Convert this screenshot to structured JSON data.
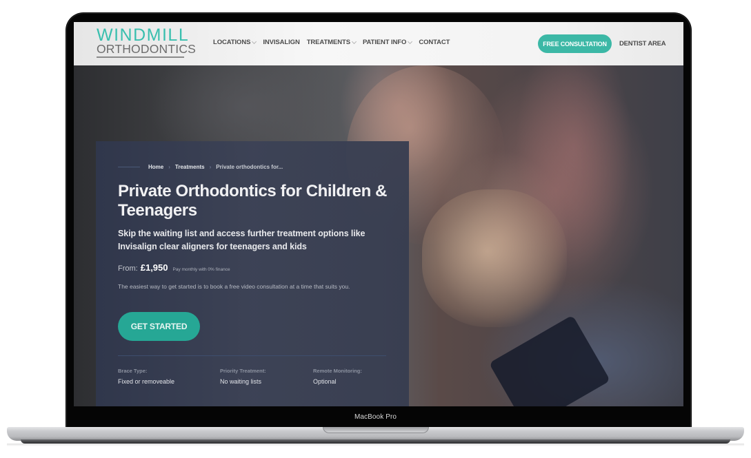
{
  "device": {
    "model_label": "MacBook Pro"
  },
  "header": {
    "logo": {
      "line1": "WINDMILL",
      "line2": "ORTHODONTICS"
    },
    "nav": [
      {
        "label": "LOCATIONS",
        "has_dropdown": true
      },
      {
        "label": "INVISALIGN",
        "has_dropdown": false
      },
      {
        "label": "TREATMENTS",
        "has_dropdown": true
      },
      {
        "label": "PATIENT INFO",
        "has_dropdown": true
      },
      {
        "label": "CONTACT",
        "has_dropdown": false
      }
    ],
    "cta_label": "FREE CONSULTATION",
    "dentist_area_label": "DENTIST AREA"
  },
  "hero": {
    "breadcrumb": [
      {
        "label": "Home"
      },
      {
        "label": "Treatments"
      },
      {
        "label": "Private orthodontics for..."
      }
    ],
    "title": "Private Orthodontics for Children & Teenagers",
    "subtitle": "Skip the waiting list and access further treatment options like Invisalign clear aligners for teenagers and kids",
    "price": {
      "from_label": "From:",
      "value": "£1,950",
      "note": "Pay monthly with 0% finance"
    },
    "intro": "The easiest way to get started is to book a free video consultation at a time that suits you.",
    "get_started_label": "GET STARTED",
    "facts": [
      {
        "label": "Brace Type:",
        "value": "Fixed or removeable"
      },
      {
        "label": "Priority Treatment:",
        "value": "No waiting lists"
      },
      {
        "label": "Remote Monitoring:",
        "value": "Optional"
      }
    ]
  },
  "colors": {
    "brand_teal": "#39bfae",
    "cta_teal": "#3cb8a6",
    "button_teal": "#26a795",
    "card_navy": "#30374c",
    "logo_gray": "#6c6c6c"
  }
}
